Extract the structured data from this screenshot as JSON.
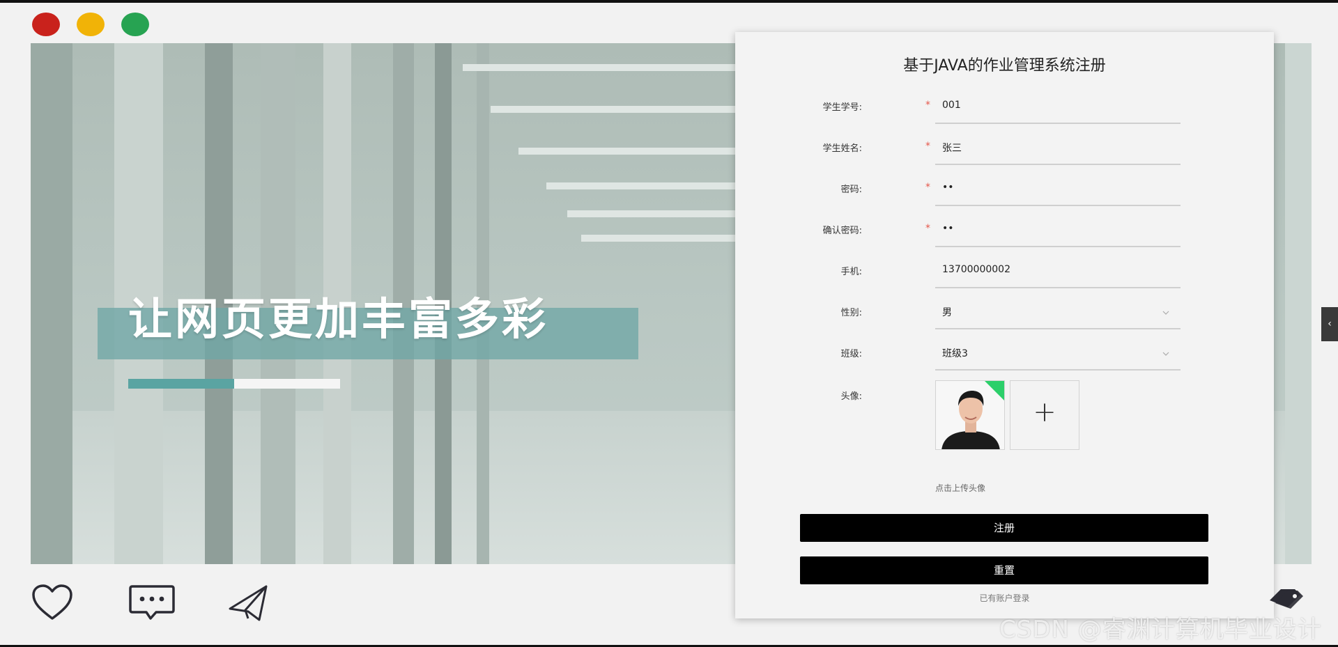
{
  "window": {
    "dot_colors": [
      "#c9221c",
      "#f1b307",
      "#27a352"
    ]
  },
  "hero": {
    "slogan": "让网页更加丰富多彩",
    "progress_fraction": 0.5,
    "accent": "#5aa4a2"
  },
  "form": {
    "title": "基于JAVA的作业管理系统注册",
    "fields": [
      {
        "label": "学生学号:",
        "required": true,
        "value": "001"
      },
      {
        "label": "学生姓名:",
        "required": true,
        "value": "张三"
      },
      {
        "label": "密码:",
        "required": true,
        "value": "••"
      },
      {
        "label": "确认密码:",
        "required": true,
        "value": "••"
      },
      {
        "label": "手机:",
        "required": false,
        "value": "13700000002"
      },
      {
        "label": "性别:",
        "required": false,
        "value": "男",
        "select": true
      },
      {
        "label": "班级:",
        "required": false,
        "value": "班级3",
        "select": true
      }
    ],
    "avatar_label": "头像:",
    "uploader_symbol": "+",
    "upload_tip": "点击上传头像",
    "register_label": "注册",
    "reset_label": "重置",
    "login_link": "已有账户登录",
    "required_mark": "*"
  },
  "side_tab": {
    "symbol": "‹"
  },
  "bottom_icons": [
    "heart-icon",
    "chat-bubble-icon",
    "paper-plane-icon",
    "tag-icon"
  ],
  "watermark": "CSDN @睿渊计算机毕业设计"
}
